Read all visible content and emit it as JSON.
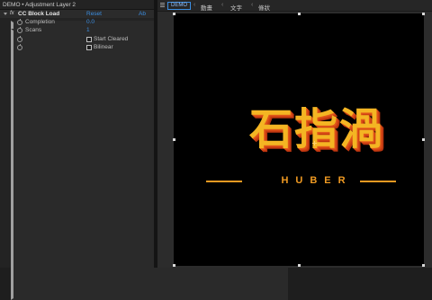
{
  "effect_controls": {
    "title": "DEMO • Adjustment Layer 2",
    "effect": {
      "fx_badge": "fx",
      "name": "CC Block Load",
      "reset_label": "Reset",
      "about_label": "Ab"
    },
    "properties": [
      {
        "label": "Completion",
        "value": "0.0"
      },
      {
        "label": "Scans",
        "value": "1"
      }
    ],
    "checkboxes": [
      {
        "label": "Start Cleared",
        "checked": false
      },
      {
        "label": "Bilinear",
        "checked": false
      }
    ]
  },
  "composition": {
    "tab_label": "DEMO",
    "breadcrumbs": [
      "動畫",
      "文字",
      "條狀"
    ],
    "canvas_background": "#000000",
    "logo": {
      "main_text": "石指渦",
      "sub_text": "HUBER",
      "main_color": "#f4b523",
      "shadow_color": "#d84a16"
    }
  },
  "colors": {
    "link": "#3b8de0",
    "panel_bg": "#232323",
    "viewer_bg": "#2c2c2c"
  }
}
